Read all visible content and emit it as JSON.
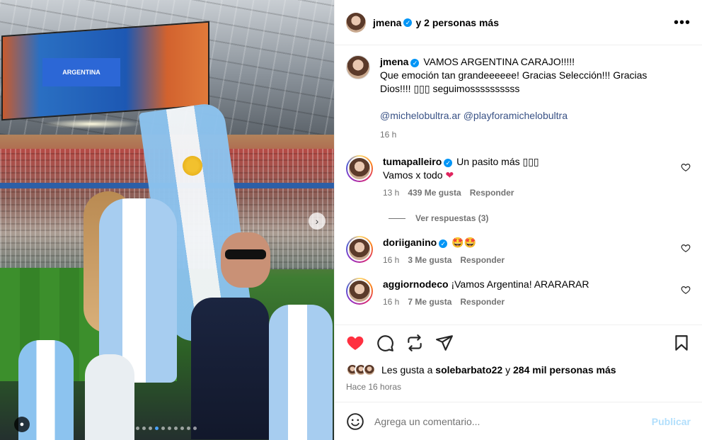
{
  "header": {
    "username": "jmena",
    "collaborators": "y 2 personas más"
  },
  "caption": {
    "username": "jmena",
    "text_line1": "VAMOS ARGENTINA CARAJO!!!!!",
    "text_line2": "Que emoción tan grandeeeeee! Gracias Selección!!! Gracias",
    "text_line3": "Dios!!!! ▯▯▯ seguimossssssssss",
    "mention1": "@michelobultra.ar",
    "mention2": "@playforamichelobultra",
    "time": "16 h"
  },
  "comments": [
    {
      "username": "tumapalleiro",
      "text": "Un pasito más ▯▯▯",
      "text2": "Vamos x todo",
      "time": "13 h",
      "likes": "439 Me gusta",
      "reply": "Responder"
    },
    {
      "username": "doriiganino",
      "text": "🤩🤩",
      "time": "16 h",
      "likes": "3 Me gusta",
      "reply": "Responder"
    },
    {
      "username": "aggiornodeco",
      "text": "¡Vamos Argentina! ARARARAR",
      "time": "16 h",
      "likes": "7 Me gusta",
      "reply": "Responder"
    }
  ],
  "replies_toggle": "Ver respuestas (3)",
  "likes": {
    "prefix": "Les gusta a",
    "user": "solebarbato22",
    "middle": "y",
    "others": "284 mil personas más"
  },
  "post_time": "Hace 16 horas",
  "composer": {
    "placeholder": "Agrega un comentario...",
    "publish": "Publicar"
  },
  "photo": {
    "screen_text": "ARGENTINA",
    "carousel_count": 10,
    "carousel_active": 3
  },
  "colors": {
    "like": "#ff3040",
    "link": "#385185",
    "verified": "#0095f6",
    "publish": "#b2dffc",
    "muted": "#737373"
  }
}
